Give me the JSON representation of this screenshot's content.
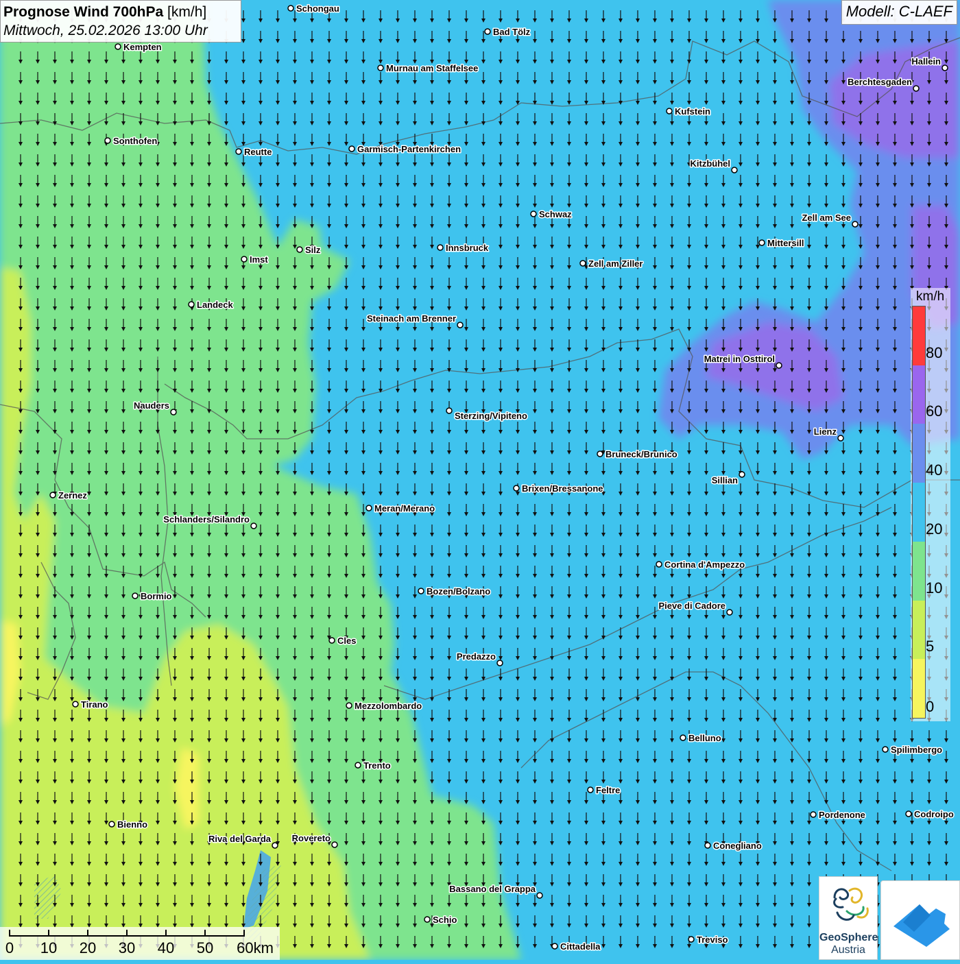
{
  "header": {
    "title_bold": "Prognose Wind 700hPa",
    "title_unit": "[km/h]",
    "subtitle": "Mittwoch, 25.02.2026 13:00 Uhr",
    "model": "Modell: C-LAEF"
  },
  "legend": {
    "unit": "km/h",
    "ticks": [
      "80",
      "60",
      "40",
      "20",
      "10",
      "5",
      "0"
    ],
    "colors": [
      "#ff3b3b",
      "#9a66ee",
      "#6b8eee",
      "#3fc3ee",
      "#7ee48e",
      "#c8ef5a",
      "#f6f55e"
    ],
    "boundaries": [
      0,
      5,
      10,
      20,
      40,
      60,
      80
    ]
  },
  "map": {
    "wind_direction": "north",
    "cities": [
      {
        "name": "Schongau"
      },
      {
        "name": "Bad Tölz"
      },
      {
        "name": "Kempten"
      },
      {
        "name": "Murnau am Staffelsee"
      },
      {
        "name": "Hallein"
      },
      {
        "name": "Berchtesgaden"
      },
      {
        "name": "Kufstein"
      },
      {
        "name": "Sonthofen"
      },
      {
        "name": "Reutte"
      },
      {
        "name": "Garmisch-Partenkirchen"
      },
      {
        "name": "Kitzbühel"
      },
      {
        "name": "Schwaz"
      },
      {
        "name": "Zell am See"
      },
      {
        "name": "Silz"
      },
      {
        "name": "Innsbruck"
      },
      {
        "name": "Mittersill"
      },
      {
        "name": "Imst"
      },
      {
        "name": "Zell am Ziller"
      },
      {
        "name": "Landeck"
      },
      {
        "name": "Steinach am Brenner"
      },
      {
        "name": "Matrei in Osttirol"
      },
      {
        "name": "Nauders"
      },
      {
        "name": "Sterzing/Vipiteno"
      },
      {
        "name": "Lienz"
      },
      {
        "name": "Bruneck/Brunico"
      },
      {
        "name": "Sillian"
      },
      {
        "name": "Brixen/Bressanone"
      },
      {
        "name": "Zernez"
      },
      {
        "name": "Meran/Merano"
      },
      {
        "name": "Schlanders/Silandro"
      },
      {
        "name": "Cortina d'Ampezzo"
      },
      {
        "name": "Bozen/Bolzano"
      },
      {
        "name": "Bormio"
      },
      {
        "name": "Pieve di Cadore"
      },
      {
        "name": "Cles"
      },
      {
        "name": "Predazzo"
      },
      {
        "name": "Tirano"
      },
      {
        "name": "Mezzolombardo"
      },
      {
        "name": "Belluno"
      },
      {
        "name": "Spilimbergo"
      },
      {
        "name": "Trento"
      },
      {
        "name": "Feltre"
      },
      {
        "name": "Bienno"
      },
      {
        "name": "Pordenone"
      },
      {
        "name": "Codroipo"
      },
      {
        "name": "Riva del Garda"
      },
      {
        "name": "Rovereto"
      },
      {
        "name": "Conegliano"
      },
      {
        "name": "Bassano del Grappa"
      },
      {
        "name": "Schio"
      },
      {
        "name": "Treviso"
      },
      {
        "name": "Cittadella"
      }
    ]
  },
  "scale": {
    "labels": [
      "0",
      "10",
      "20",
      "30",
      "40",
      "50",
      "60km"
    ]
  },
  "logos": {
    "geosphere_name": "GeoSphere",
    "geosphere_sub": "Austria"
  }
}
